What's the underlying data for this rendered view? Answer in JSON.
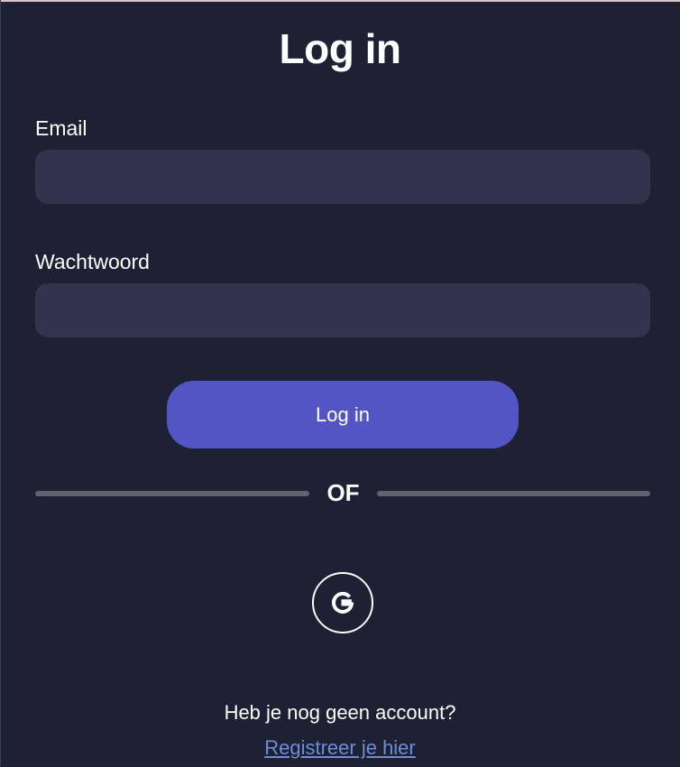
{
  "login": {
    "title": "Log in",
    "email_label": "Email",
    "email_value": "",
    "password_label": "Wachtwoord",
    "password_value": "",
    "submit_label": "Log in",
    "divider_text": "OF",
    "social_icon": "google-icon",
    "no_account_text": "Heb je nog geen account?",
    "register_link": "Registreer je hier"
  },
  "colors": {
    "background": "#1e2033",
    "input_background": "#31344b",
    "accent": "#5355c4",
    "divider": "#61636f",
    "link": "#6b8ed8",
    "text": "#ffffff"
  }
}
